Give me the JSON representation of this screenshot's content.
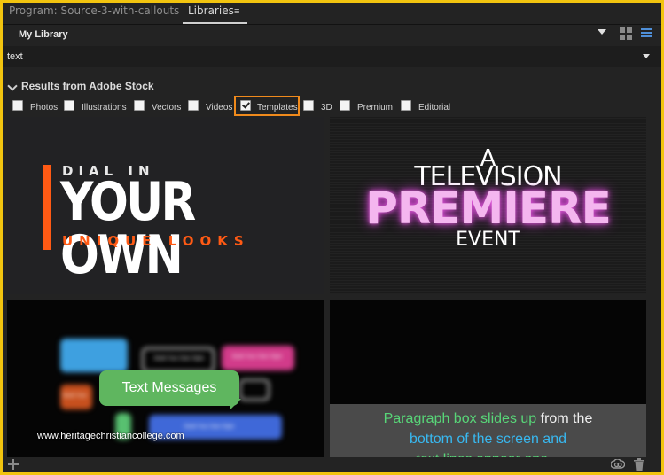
{
  "tabs": {
    "program": "Program: Source-3-with-callouts",
    "libraries": "Libraries",
    "menu_glyph": "≡"
  },
  "library": {
    "name": "My Library"
  },
  "search": {
    "value": "text"
  },
  "results": {
    "title": "Results from Adobe Stock"
  },
  "filters": [
    {
      "label": "Photos",
      "checked": false
    },
    {
      "label": "Illustrations",
      "checked": false
    },
    {
      "label": "Vectors",
      "checked": false
    },
    {
      "label": "Videos",
      "checked": false
    },
    {
      "label": "Templates",
      "checked": true
    },
    {
      "label": "3D",
      "checked": false
    },
    {
      "label": "Premium",
      "checked": false
    },
    {
      "label": "Editorial",
      "checked": false
    }
  ],
  "thumbnails": {
    "t1": {
      "line1": "DIAL IN",
      "line2": "YOUR OWN",
      "line3": "UNIQUE LOOKS"
    },
    "t2": {
      "line1": "A",
      "line2": "TELEVISION",
      "line3": "PREMIERE",
      "line4": "EVENT"
    },
    "t3": {
      "bubble": "Text Messages",
      "mini": "Build Your Own Style",
      "mini2": "Build Your"
    },
    "t4": {
      "l1a": "Paragraph box slides up",
      "l1b": " from the",
      "l2": "bottom of the screen and",
      "l3": "text lines appear one..."
    }
  },
  "watermark": "www.heritagechristiancollege.com",
  "colors": {
    "frame": "#f2c40f",
    "highlight": "#f08a1c",
    "accent_orange": "#ff5a14",
    "pink_glow": "#e75be0",
    "bubble_green": "#5fb65f",
    "list_blue": "#4f8fd8"
  },
  "icons": {
    "grid_view": "grid-view-icon",
    "list_view": "list-view-icon",
    "add": "plus-icon",
    "cc": "creative-cloud-icon",
    "trash": "trash-icon"
  }
}
